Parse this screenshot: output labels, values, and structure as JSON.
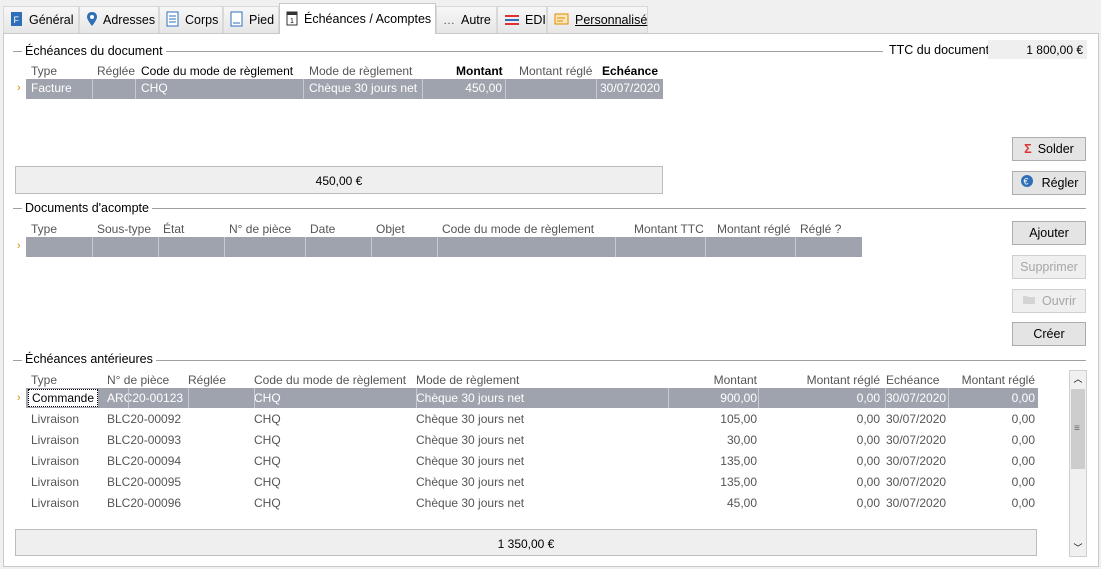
{
  "tabs": [
    {
      "label": "Général",
      "icon": "document-blue-icon"
    },
    {
      "label": "Adresses",
      "icon": "map-pin-icon"
    },
    {
      "label": "Corps",
      "icon": "document-lines-icon"
    },
    {
      "label": "Pied",
      "icon": "document-icon"
    },
    {
      "label": "Échéances / Acomptes",
      "icon": "calendar-icon",
      "active": true
    },
    {
      "label": "Autre",
      "icon": "ellipsis-icon"
    },
    {
      "label": "EDI",
      "icon": "edi-icon"
    },
    {
      "label": "Personnalisé",
      "icon": "custom-icon"
    }
  ],
  "echeances": {
    "title": "Échéances du document",
    "ttc_label": "TTC du document",
    "ttc_value": "1 800,00 €",
    "columns": [
      "Type",
      "Réglée",
      "Code du mode de règlement",
      "Mode de règlement",
      "Montant",
      "Montant réglé",
      "Echéance"
    ],
    "row": {
      "type": "Facture",
      "reglee": "",
      "code": "CHQ",
      "mode": "Chèque 30 jours net",
      "montant": "450,00",
      "montant_regle": "",
      "echeance": "30/07/2020"
    },
    "total": "450,00 €",
    "solder_label": "Solder",
    "regler_label": "Régler"
  },
  "acomptes": {
    "title": "Documents d'acompte",
    "columns": [
      "Type",
      "Sous-type",
      "État",
      "N° de pièce",
      "Date",
      "Objet",
      "Code du mode de règlement",
      "Montant TTC",
      "Montant réglé",
      "Réglé ?"
    ],
    "buttons": {
      "ajouter": "Ajouter",
      "supprimer": "Supprimer",
      "ouvrir": "Ouvrir",
      "creer": "Créer"
    }
  },
  "anterieures": {
    "title": "Échéances antérieures",
    "columns": [
      "Type",
      "N° de pièce",
      "Réglée",
      "Code du mode de règlement",
      "Mode de règlement",
      "Montant",
      "Montant réglé",
      "Echéance",
      "Montant réglé"
    ],
    "rows": [
      [
        "Commande",
        "ARC20-00123",
        "",
        "CHQ",
        "Chèque 30 jours net",
        "900,00",
        "0,00",
        "30/07/2020",
        "0,00"
      ],
      [
        "Livraison",
        "BLC20-00092",
        "",
        "CHQ",
        "Chèque 30 jours net",
        "105,00",
        "0,00",
        "30/07/2020",
        "0,00"
      ],
      [
        "Livraison",
        "BLC20-00093",
        "",
        "CHQ",
        "Chèque 30 jours net",
        "30,00",
        "0,00",
        "30/07/2020",
        "0,00"
      ],
      [
        "Livraison",
        "BLC20-00094",
        "",
        "CHQ",
        "Chèque 30 jours net",
        "135,00",
        "0,00",
        "30/07/2020",
        "0,00"
      ],
      [
        "Livraison",
        "BLC20-00095",
        "",
        "CHQ",
        "Chèque 30 jours net",
        "135,00",
        "0,00",
        "30/07/2020",
        "0,00"
      ],
      [
        "Livraison",
        "BLC20-00096",
        "",
        "CHQ",
        "Chèque 30 jours net",
        "45,00",
        "0,00",
        "30/07/2020",
        "0,00"
      ]
    ],
    "total": "1 350,00 €"
  },
  "colors": {
    "selected_row": "#9fa3ad",
    "accent_arrow": "#e08a00"
  }
}
